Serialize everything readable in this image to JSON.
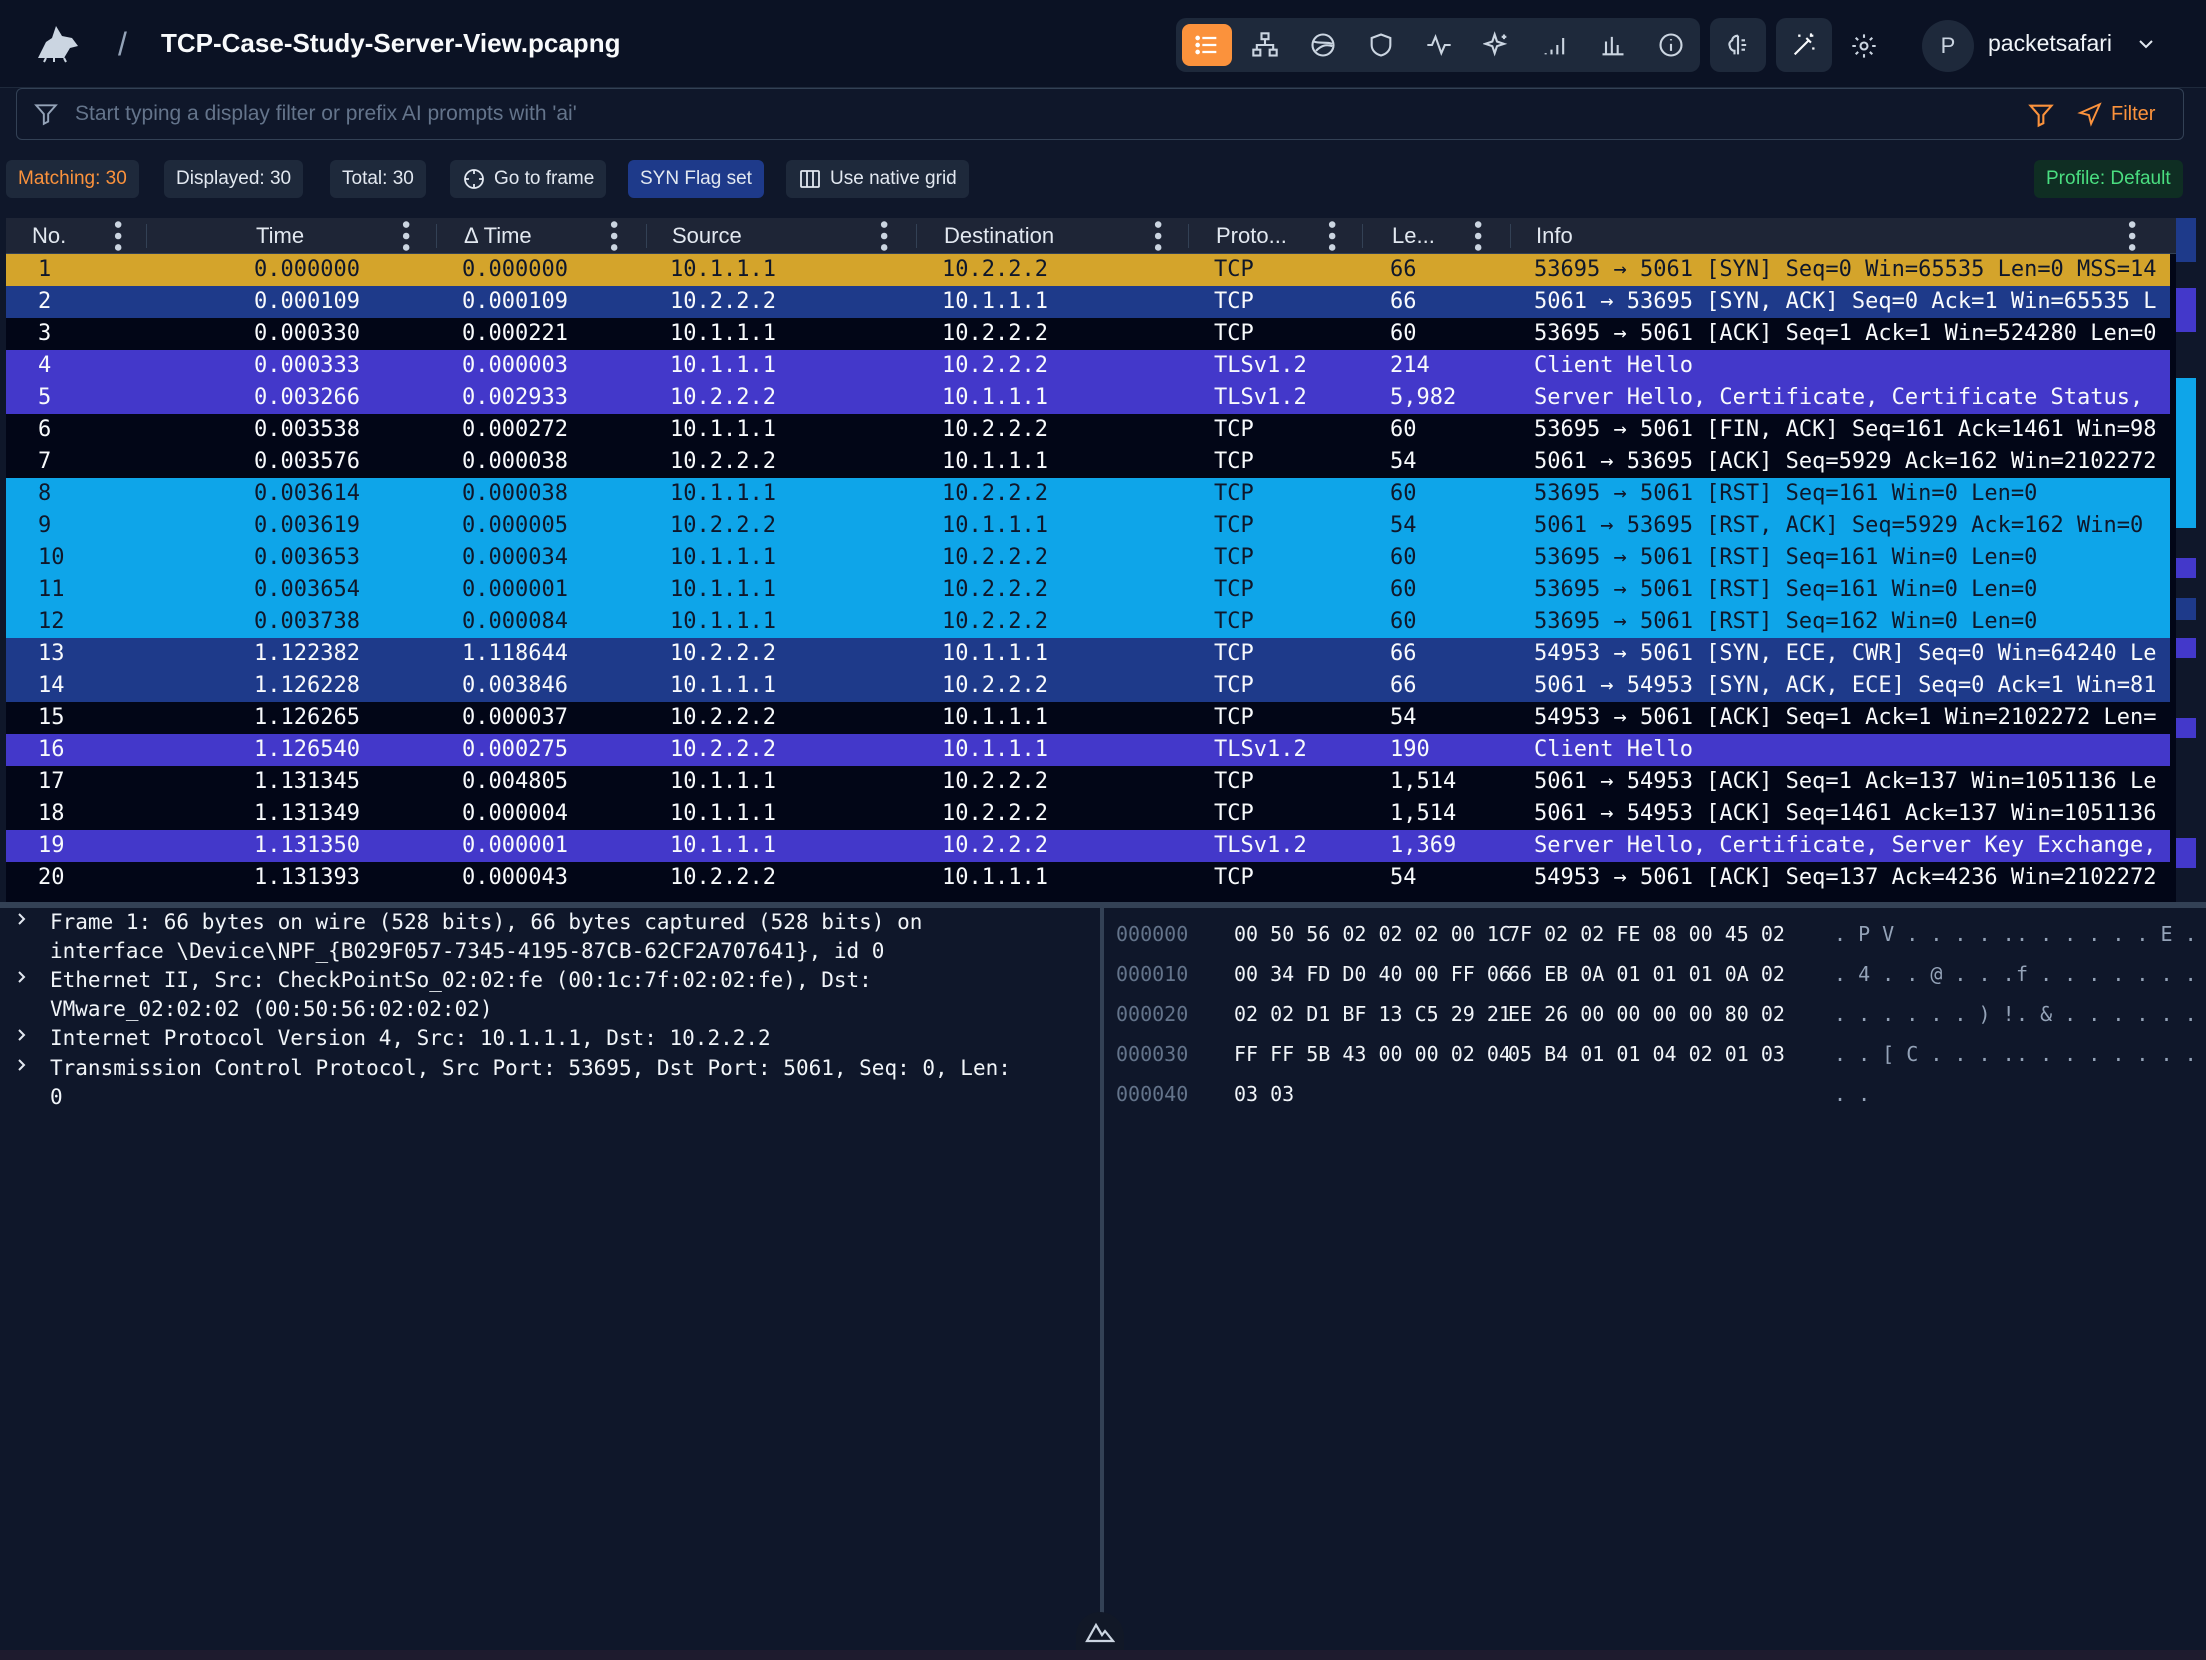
{
  "header": {
    "breadcrumb_separator": "/",
    "file_title": "TCP-Case-Study-Server-View.pcapng",
    "username": "packetsafari",
    "avatar_initial": "P",
    "toolbar_icons": [
      "list-icon",
      "hierarchy-icon",
      "globe-icon",
      "shield-icon",
      "activity-icon",
      "sparkles-icon",
      "signal-bars-icon",
      "bar-chart-icon",
      "info-icon"
    ],
    "accent_color": "#fb923c"
  },
  "filter": {
    "placeholder": "Start typing a display filter or prefix AI prompts with 'ai'",
    "value": "",
    "button_label": "Filter"
  },
  "chips": {
    "matching": "Matching: 30",
    "displayed": "Displayed: 30",
    "total": "Total: 30",
    "goto": "Go to frame",
    "syn": "SYN Flag set",
    "native_grid": "Use native grid",
    "profile": "Profile: Default"
  },
  "columns": {
    "no": "No.",
    "time": "Time",
    "delta": "Δ Time",
    "source": "Source",
    "destination": "Destination",
    "protocol": "Proto...",
    "length": "Le...",
    "info": "Info"
  },
  "packets": [
    {
      "no": "1",
      "time": "0.000000",
      "delta": "0.000000",
      "src": "10.1.1.1",
      "dst": "10.2.2.2",
      "proto": "TCP",
      "len": "66",
      "info": "53695 → 5061 [SYN] Seq=0 Win=65535 Len=0 MSS=14",
      "style": "selected"
    },
    {
      "no": "2",
      "time": "0.000109",
      "delta": "0.000109",
      "src": "10.2.2.2",
      "dst": "10.1.1.1",
      "proto": "TCP",
      "len": "66",
      "info": "5061 → 53695 [SYN, ACK] Seq=0 Ack=1 Win=65535 L",
      "style": "syn"
    },
    {
      "no": "3",
      "time": "0.000330",
      "delta": "0.000221",
      "src": "10.1.1.1",
      "dst": "10.2.2.2",
      "proto": "TCP",
      "len": "60",
      "info": "53695 → 5061 [ACK] Seq=1 Ack=1 Win=524280 Len=0",
      "style": "plain"
    },
    {
      "no": "4",
      "time": "0.000333",
      "delta": "0.000003",
      "src": "10.1.1.1",
      "dst": "10.2.2.2",
      "proto": "TLSv1.2",
      "len": "214",
      "info": "Client Hello",
      "style": "tls"
    },
    {
      "no": "5",
      "time": "0.003266",
      "delta": "0.002933",
      "src": "10.2.2.2",
      "dst": "10.1.1.1",
      "proto": "TLSv1.2",
      "len": "5,982",
      "info": "Server Hello, Certificate, Certificate Status,",
      "style": "tls"
    },
    {
      "no": "6",
      "time": "0.003538",
      "delta": "0.000272",
      "src": "10.1.1.1",
      "dst": "10.2.2.2",
      "proto": "TCP",
      "len": "60",
      "info": "53695 → 5061 [FIN, ACK] Seq=161 Ack=1461 Win=98",
      "style": "plain"
    },
    {
      "no": "7",
      "time": "0.003576",
      "delta": "0.000038",
      "src": "10.2.2.2",
      "dst": "10.1.1.1",
      "proto": "TCP",
      "len": "54",
      "info": "5061 → 53695 [ACK] Seq=5929 Ack=162 Win=2102272",
      "style": "plain"
    },
    {
      "no": "8",
      "time": "0.003614",
      "delta": "0.000038",
      "src": "10.1.1.1",
      "dst": "10.2.2.2",
      "proto": "TCP",
      "len": "60",
      "info": "53695 → 5061 [RST] Seq=161 Win=0 Len=0",
      "style": "rst"
    },
    {
      "no": "9",
      "time": "0.003619",
      "delta": "0.000005",
      "src": "10.2.2.2",
      "dst": "10.1.1.1",
      "proto": "TCP",
      "len": "54",
      "info": "5061 → 53695 [RST, ACK] Seq=5929 Ack=162 Win=0",
      "style": "rst"
    },
    {
      "no": "10",
      "time": "0.003653",
      "delta": "0.000034",
      "src": "10.1.1.1",
      "dst": "10.2.2.2",
      "proto": "TCP",
      "len": "60",
      "info": "53695 → 5061 [RST] Seq=161 Win=0 Len=0",
      "style": "rst"
    },
    {
      "no": "11",
      "time": "0.003654",
      "delta": "0.000001",
      "src": "10.1.1.1",
      "dst": "10.2.2.2",
      "proto": "TCP",
      "len": "60",
      "info": "53695 → 5061 [RST] Seq=161 Win=0 Len=0",
      "style": "rst"
    },
    {
      "no": "12",
      "time": "0.003738",
      "delta": "0.000084",
      "src": "10.1.1.1",
      "dst": "10.2.2.2",
      "proto": "TCP",
      "len": "60",
      "info": "53695 → 5061 [RST] Seq=162 Win=0 Len=0",
      "style": "rst"
    },
    {
      "no": "13",
      "time": "1.122382",
      "delta": "1.118644",
      "src": "10.2.2.2",
      "dst": "10.1.1.1",
      "proto": "TCP",
      "len": "66",
      "info": "54953 → 5061 [SYN, ECE, CWR] Seq=0 Win=64240 Le",
      "style": "syn"
    },
    {
      "no": "14",
      "time": "1.126228",
      "delta": "0.003846",
      "src": "10.1.1.1",
      "dst": "10.2.2.2",
      "proto": "TCP",
      "len": "66",
      "info": "5061 → 54953 [SYN, ACK, ECE] Seq=0 Ack=1 Win=81",
      "style": "syn"
    },
    {
      "no": "15",
      "time": "1.126265",
      "delta": "0.000037",
      "src": "10.2.2.2",
      "dst": "10.1.1.1",
      "proto": "TCP",
      "len": "54",
      "info": "54953 → 5061 [ACK] Seq=1 Ack=1 Win=2102272 Len=",
      "style": "plain"
    },
    {
      "no": "16",
      "time": "1.126540",
      "delta": "0.000275",
      "src": "10.2.2.2",
      "dst": "10.1.1.1",
      "proto": "TLSv1.2",
      "len": "190",
      "info": "Client Hello",
      "style": "tls"
    },
    {
      "no": "17",
      "time": "1.131345",
      "delta": "0.004805",
      "src": "10.1.1.1",
      "dst": "10.2.2.2",
      "proto": "TCP",
      "len": "1,514",
      "info": "5061 → 54953 [ACK] Seq=1 Ack=137 Win=1051136 Le",
      "style": "plain"
    },
    {
      "no": "18",
      "time": "1.131349",
      "delta": "0.000004",
      "src": "10.1.1.1",
      "dst": "10.2.2.2",
      "proto": "TCP",
      "len": "1,514",
      "info": "5061 → 54953 [ACK] Seq=1461 Ack=137 Win=1051136",
      "style": "plain"
    },
    {
      "no": "19",
      "time": "1.131350",
      "delta": "0.000001",
      "src": "10.1.1.1",
      "dst": "10.2.2.2",
      "proto": "TLSv1.2",
      "len": "1,369",
      "info": "Server Hello, Certificate, Server Key Exchange,",
      "style": "tls"
    },
    {
      "no": "20",
      "time": "1.131393",
      "delta": "0.000043",
      "src": "10.2.2.2",
      "dst": "10.1.1.1",
      "proto": "TCP",
      "len": "54",
      "info": "54953 → 5061 [ACK] Seq=137 Ack=4236 Win=2102272",
      "style": "plain"
    }
  ],
  "row_colors": {
    "selected": "#d4a42b",
    "syn": "#1e3a8a",
    "tls": "#4338ca",
    "rst": "#0ea5e9",
    "plain": "#020617"
  },
  "details": [
    "Frame 1: 66 bytes on wire (528 bits), 66 bytes captured (528 bits) on\ninterface \\Device\\NPF_{B029F057-7345-4195-87CB-62CF2A707641}, id 0",
    "Ethernet II, Src: CheckPointSo_02:02:fe (00:1c:7f:02:02:fe), Dst:\nVMware_02:02:02 (00:50:56:02:02:02)",
    "Internet Protocol Version 4, Src: 10.1.1.1, Dst: 10.2.2.2",
    "Transmission Control Protocol, Src Port: 53695, Dst Port: 5061, Seq: 0, Len:\n0"
  ],
  "hex": [
    {
      "offset": "000000",
      "bytes1": "00 50 56 02 02 02 00 1C",
      "bytes2": "7F 02 02 FE 08 00 45 02",
      "ascii1": ". P V . . . . .",
      "ascii2": ". . . . . . E ."
    },
    {
      "offset": "000010",
      "bytes1": "00 34 FD D0 40 00 FF 06",
      "bytes2": "66 EB 0A 01 01 01 0A 02",
      "ascii1": ". 4 . . @ . . .",
      "ascii2": "f . . . . . . ."
    },
    {
      "offset": "000020",
      "bytes1": "02 02 D1 BF 13 C5 29 21",
      "bytes2": "EE 26 00 00 00 00 80 02",
      "ascii1": ". . . . . . ) !",
      "ascii2": ". & . . . . . ."
    },
    {
      "offset": "000030",
      "bytes1": "FF FF 5B 43 00 00 02 04",
      "bytes2": "05 B4 01 01 04 02 01 03",
      "ascii1": ". . [ C . . . .",
      "ascii2": ". . . . . . . ."
    },
    {
      "offset": "000040",
      "bytes1": "03 03",
      "bytes2": "",
      "ascii1": ". .",
      "ascii2": ""
    }
  ]
}
